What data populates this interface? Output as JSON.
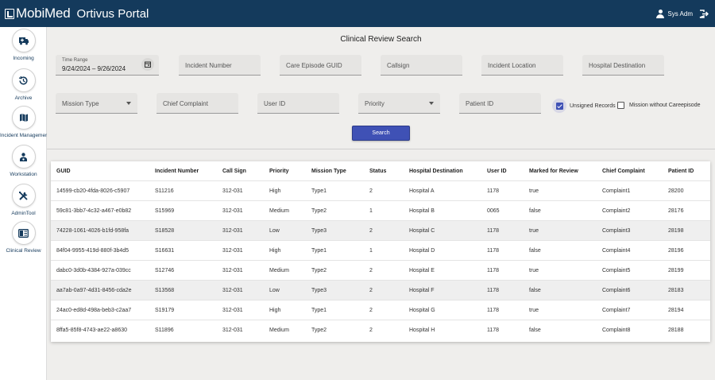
{
  "header": {
    "logo_text": "MobiMed",
    "portal_title": "Ortivus Portal",
    "user_name": "Sys Adm"
  },
  "sidebar": {
    "items": [
      {
        "label": "Incoming",
        "icon": "ambulance-icon"
      },
      {
        "label": "Archive",
        "icon": "history-icon"
      },
      {
        "label": "Incident Management",
        "icon": "map-icon"
      },
      {
        "label": "Workstation",
        "icon": "workstation-icon"
      },
      {
        "label": "AdminTool",
        "icon": "tools-icon"
      },
      {
        "label": "Clinical Review",
        "icon": "review-icon"
      }
    ]
  },
  "search": {
    "title": "Clinical Review Search",
    "time_range_label": "Time Range",
    "time_range_value": "9/24/2024  – 9/26/2024",
    "incident_number": "Incident Number",
    "care_episode_guid": "Care Episode GUID",
    "callsign": "Callsign",
    "incident_location": "Incident Location",
    "hospital_destination": "Hospital Destination",
    "mission_type": "Mission Type",
    "chief_complaint": "Chief Complaint",
    "user_id": "User ID",
    "priority": "Priority",
    "patient_id": "Patient ID",
    "unsigned_records": "Unsigned Records",
    "unsigned_records_checked": true,
    "mission_without_careepisode": "Mission without Careepisode",
    "mission_without_careepisode_checked": false,
    "search_button": "Search"
  },
  "table": {
    "columns": [
      "GUID",
      "Incident Number",
      "Call Sign",
      "Priority",
      "Mission Type",
      "Status",
      "Hospital Destination",
      "User ID",
      "Marked for Review",
      "Chief Complaint",
      "Patient ID"
    ],
    "rows": [
      [
        "14599-cb20-4fda-8026-c5907",
        "S11216",
        "312-031",
        "High",
        "Type1",
        "2",
        "Hospital A",
        "1178",
        "true",
        "Complaint1",
        "28200"
      ],
      [
        "59c81-3bb7-4c32-a467-e0b82",
        "S15969",
        "312-031",
        "Medium",
        "Type2",
        "1",
        "Hospital B",
        "0065",
        "false",
        "Complaint2",
        "28176"
      ],
      [
        "74228-1061-4026-b1fd-958fa",
        "S18528",
        "312-031",
        "Low",
        "Type3",
        "2",
        "Hospital C",
        "1178",
        "true",
        "Complaint3",
        "28198"
      ],
      [
        "84f04-9955-419d-880f-3b4d5",
        "S16631",
        "312-031",
        "High",
        "Type1",
        "1",
        "Hospital D",
        "1178",
        "false",
        "Complaint4",
        "28196"
      ],
      [
        "dabc0-3d0b-4384-927a-039cc",
        "S12746",
        "312-031",
        "Medium",
        "Type2",
        "2",
        "Hospital E",
        "1178",
        "true",
        "Complaint5",
        "28199"
      ],
      [
        "aa7ab-0a97-4d31-8456-cda2e",
        "S13568",
        "312-031",
        "Low",
        "Type3",
        "2",
        "Hospital F",
        "1178",
        "false",
        "Complaint6",
        "28183"
      ],
      [
        "24ac0-ed8d-498a-beb3-c2aa7",
        "S19179",
        "312-031",
        "High",
        "Type1",
        "2",
        "Hospital G",
        "1178",
        "true",
        "Complaint7",
        "28194"
      ],
      [
        "8ffa5-85f8-4743-ae22-a8630",
        "S11896",
        "312-031",
        "Medium",
        "Type2",
        "2",
        "Hospital H",
        "1178",
        "false",
        "Complaint8",
        "28188"
      ]
    ]
  },
  "colors": {
    "header_bg": "#143a5c",
    "accent": "#3f51b5",
    "page_bg": "#efeeec"
  }
}
